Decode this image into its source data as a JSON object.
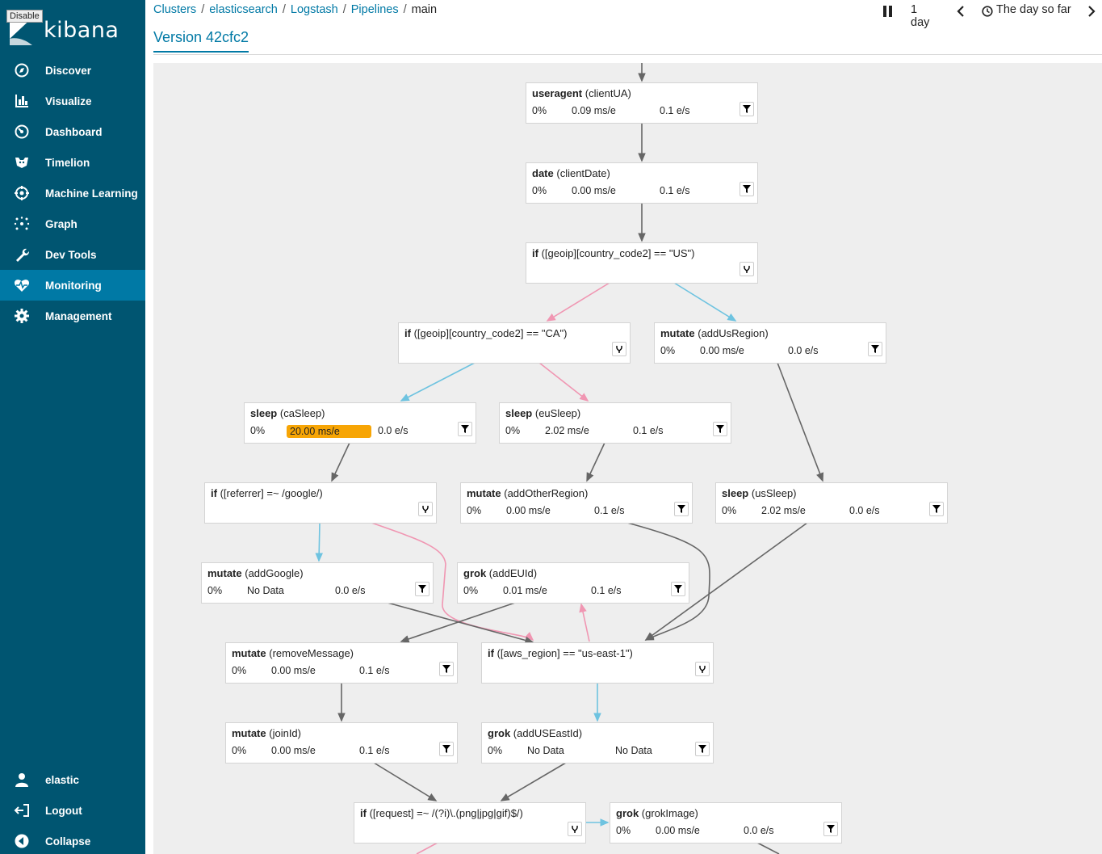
{
  "disable_label": "Disable",
  "app": {
    "logo_text": "kibana"
  },
  "nav": {
    "discover": "Discover",
    "visualize": "Visualize",
    "dashboard": "Dashboard",
    "timelion": "Timelion",
    "ml": "Machine Learning",
    "graph": "Graph",
    "devtools": "Dev Tools",
    "monitoring": "Monitoring",
    "management": "Management",
    "user": "elastic",
    "logout": "Logout",
    "collapse": "Collapse"
  },
  "breadcrumb": {
    "clusters": "Clusters",
    "elasticsearch": "elasticsearch",
    "logstash": "Logstash",
    "pipelines": "Pipelines",
    "current": "main",
    "separator": "/"
  },
  "tab": "Version 42cfc2",
  "time": {
    "interval": "1 day",
    "range": "The day so far"
  },
  "colors": {
    "sidebar": "#005571",
    "active": "#0079a5",
    "slow": "#f7a505",
    "true_edge": "#6ec3e0",
    "false_edge": "#f096b2",
    "edge": "#666666"
  },
  "vertices": {
    "useragent": {
      "type": "useragent",
      "id": "(clientUA)",
      "pct": "0%",
      "ms": "0.09 ms/e",
      "eps": "0.1 e/s"
    },
    "date": {
      "type": "date",
      "id": "(clientDate)",
      "pct": "0%",
      "ms": "0.00 ms/e",
      "eps": "0.1 e/s"
    },
    "if_us": {
      "type": "if",
      "cond": "([geoip][country_code2] == \"US\")"
    },
    "if_ca": {
      "type": "if",
      "cond": "([geoip][country_code2] == \"CA\")"
    },
    "mutate_us": {
      "type": "mutate",
      "id": "(addUsRegion)",
      "pct": "0%",
      "ms": "0.00 ms/e",
      "eps": "0.0 e/s"
    },
    "sleep_ca": {
      "type": "sleep",
      "id": "(caSleep)",
      "pct": "0%",
      "ms": "20.00 ms/e",
      "eps": "0.0 e/s"
    },
    "sleep_eu": {
      "type": "sleep",
      "id": "(euSleep)",
      "pct": "0%",
      "ms": "2.02 ms/e",
      "eps": "0.1 e/s"
    },
    "if_ref": {
      "type": "if",
      "cond": "([referrer] =~ /google/)"
    },
    "mutate_other": {
      "type": "mutate",
      "id": "(addOtherRegion)",
      "pct": "0%",
      "ms": "0.00 ms/e",
      "eps": "0.1 e/s"
    },
    "sleep_us": {
      "type": "sleep",
      "id": "(usSleep)",
      "pct": "0%",
      "ms": "2.02 ms/e",
      "eps": "0.0 e/s"
    },
    "mutate_google": {
      "type": "mutate",
      "id": "(addGoogle)",
      "pct": "0%",
      "ms": "No Data",
      "eps": "0.0 e/s"
    },
    "grok_eu": {
      "type": "grok",
      "id": "(addEUId)",
      "pct": "0%",
      "ms": "0.01 ms/e",
      "eps": "0.1 e/s"
    },
    "mutate_remove": {
      "type": "mutate",
      "id": "(removeMessage)",
      "pct": "0%",
      "ms": "0.00 ms/e",
      "eps": "0.1 e/s"
    },
    "if_aws": {
      "type": "if",
      "cond": "([aws_region] == \"us-east-1\")"
    },
    "mutate_join": {
      "type": "mutate",
      "id": "(joinId)",
      "pct": "0%",
      "ms": "0.00 ms/e",
      "eps": "0.1 e/s"
    },
    "grok_useast": {
      "type": "grok",
      "id": "(addUSEastId)",
      "pct": "0%",
      "ms": "No Data",
      "eps": "No Data"
    },
    "if_req": {
      "type": "if",
      "cond": "([request] =~ /(?i)\\.(png|jpg|gif)$/)"
    },
    "grok_image": {
      "type": "grok",
      "id": "(grokImage)",
      "pct": "0%",
      "ms": "0.00 ms/e",
      "eps": "0.0 e/s"
    }
  }
}
